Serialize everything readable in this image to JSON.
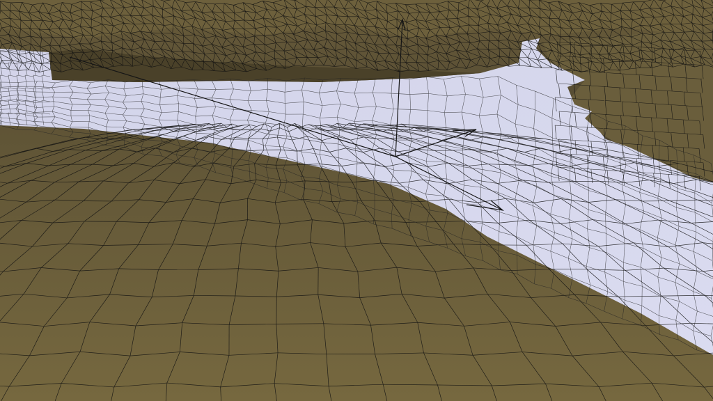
{
  "scene": {
    "kind": "3d-wireframe-terrain-viewport",
    "colors": {
      "terrain_near": "#6e6140",
      "terrain_far": "#5a4f33",
      "terrain_shadow": "#3f3822",
      "water": "#d4d5ec",
      "water_shade": "#bfc0db",
      "wire": "#111111",
      "axis": "#1a1a1a"
    },
    "objects": {
      "terrain": "terrain-mesh",
      "water": "water-surface-mesh",
      "gizmo": "transform-axis-gizmo"
    }
  }
}
